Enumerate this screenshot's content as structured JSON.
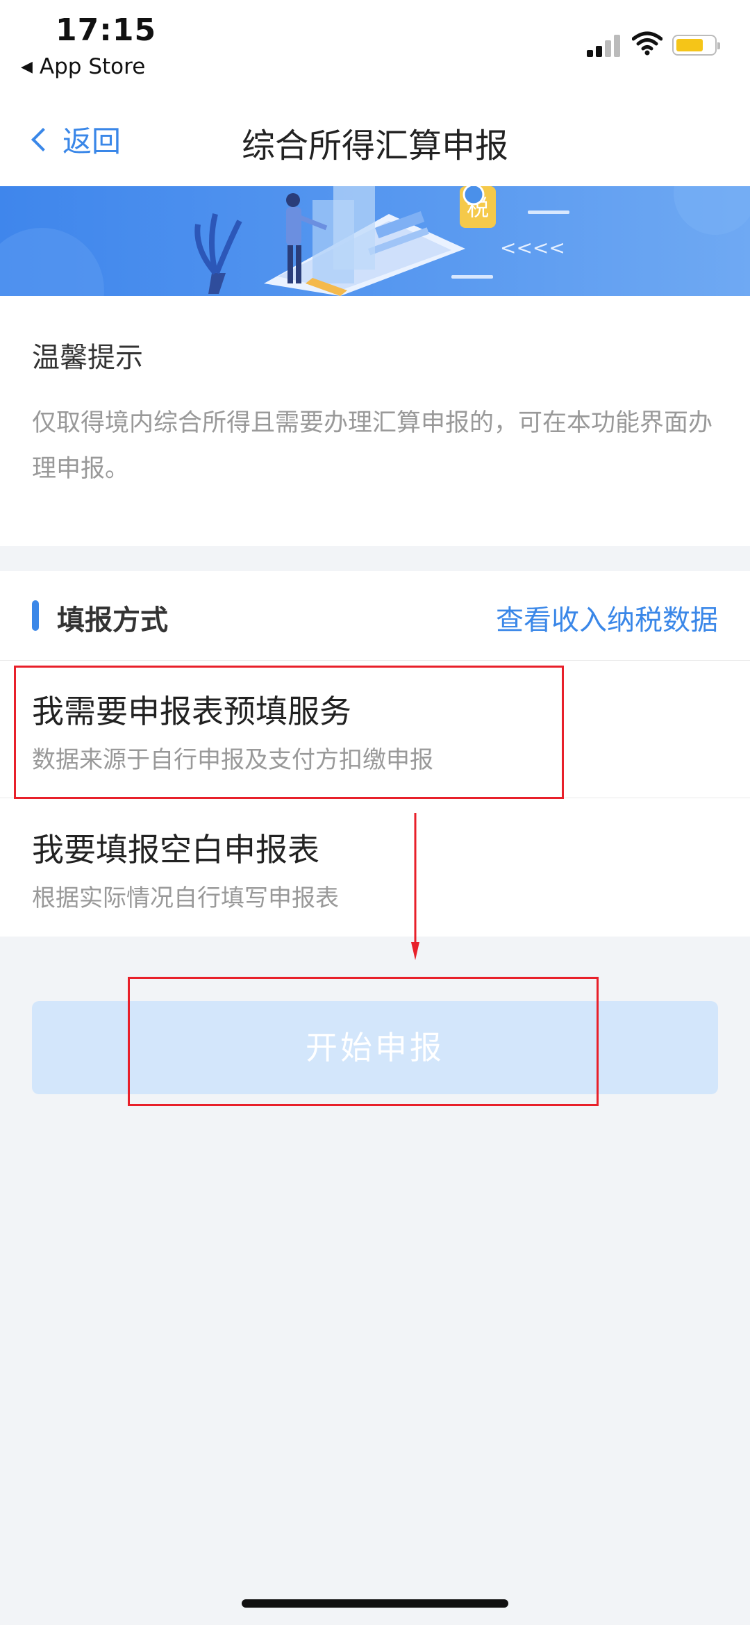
{
  "status_bar": {
    "time": "17:15",
    "back_app": "App Store",
    "icons": [
      "signal-icon",
      "wifi-icon",
      "battery-icon"
    ]
  },
  "nav": {
    "back_label": "返回",
    "title": "综合所得汇算申报"
  },
  "banner": {
    "badge": "税",
    "arrows": "<<<<"
  },
  "tips": {
    "title": "温馨提示",
    "body": "仅取得境内综合所得且需要办理汇算申报的，可在本功能界面办理申报。"
  },
  "method": {
    "title": "填报方式",
    "link": "查看收入纳税数据",
    "options": [
      {
        "title": "我需要申报表预填服务",
        "subtitle": "数据来源于自行申报及支付方扣缴申报"
      },
      {
        "title": "我要填报空白申报表",
        "subtitle": "根据实际情况自行填写申报表"
      }
    ]
  },
  "start_button": "开始申报",
  "colors": {
    "accent": "#3a87e8",
    "button_disabled": "#d3e6fb",
    "annotation": "#e8202a",
    "battery": "#f5c518"
  }
}
